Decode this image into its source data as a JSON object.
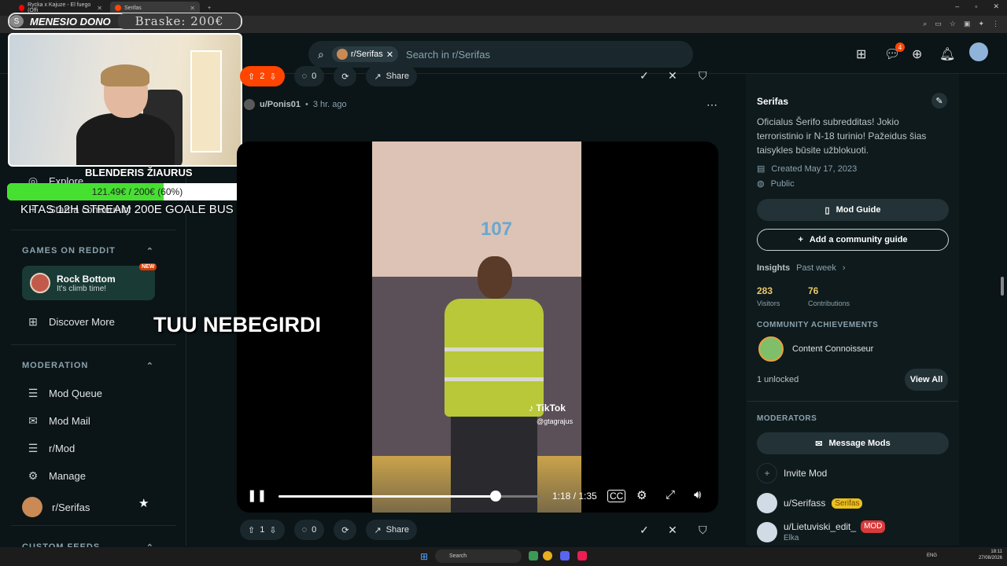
{
  "browser": {
    "tabs": [
      {
        "label": "Rycka x Kajuze - El fuego (Offi",
        "active": false
      },
      {
        "label": "Serifas",
        "active": true
      }
    ]
  },
  "header": {
    "search_chip": "r/Serifas",
    "search_placeholder": "Search in r/Serifas",
    "notification_count": "4"
  },
  "stream_overlay": {
    "donation_label": "MENESIO DONO",
    "donation_value": "Braske: 200€",
    "goal_title": "BLENDERIS ŽIAURUS",
    "goal_text": "121.49€ / 200€ (60%)",
    "goal_fraction": 0.6,
    "goal_note": "KITAS 12H STREAM 200E GOALE BUS"
  },
  "sidebar": {
    "explore_label": "Explore",
    "start_community_label": "Start a community",
    "games_heading": "GAMES ON REDDIT",
    "game": {
      "title": "Rock Bottom",
      "subtitle": "It's climb time!",
      "badge": "NEW"
    },
    "discover_label": "Discover More",
    "moderation_heading": "MODERATION",
    "mod_items": [
      "Mod Queue",
      "Mod Mail",
      "r/Mod",
      "Manage",
      "r/Serifas"
    ],
    "custom_feeds_heading": "CUSTOM FEEDS"
  },
  "post_top_bar": {
    "votes": "2",
    "comments": "0",
    "share": "Share"
  },
  "post": {
    "author": "u/Ponis01",
    "time": "3 hr. ago",
    "video": {
      "overlay_number": "107",
      "caption": "TUU NEBEGIRDI",
      "watermark": "TikTok",
      "watermark_user": "@gtagrajus",
      "time": "1:18 / 1:35",
      "progress": 0.8253
    }
  },
  "post_bottom_bar": {
    "votes": "1",
    "comments": "0",
    "share": "Share"
  },
  "right_sidebar": {
    "title": "Serifas",
    "description": "Oficialus Šerifo subredditas! Jokio terroristinio ir N-18 turinio! Pažeidus šias taisykles būsite užblokuoti.",
    "created": "Created May 17, 2023",
    "visibility": "Public",
    "mod_guide": "Mod Guide",
    "add_guide": "Add a community guide",
    "insights_label": "Insights",
    "insights_period": "Past week",
    "visitors": "283",
    "visitors_label": "Visitors",
    "contributions": "76",
    "contributions_label": "Contributions",
    "achievements_heading": "COMMUNITY ACHIEVEMENTS",
    "achievement": "Content Connoisseur",
    "unlocked": "1 unlocked",
    "view_all": "View All",
    "moderators_heading": "MODERATORS",
    "message_mods": "Message Mods",
    "invite_mod": "Invite Mod",
    "mods": [
      {
        "name": "u/Serifass",
        "flair": "Serifas"
      },
      {
        "name": "u/Lietuviski_edit_",
        "flair": "MOD",
        "sub": "Elka"
      }
    ]
  },
  "taskbar": {
    "search": "Search",
    "lang": "ENG",
    "time": "18:11",
    "date": "27/08/2026"
  }
}
